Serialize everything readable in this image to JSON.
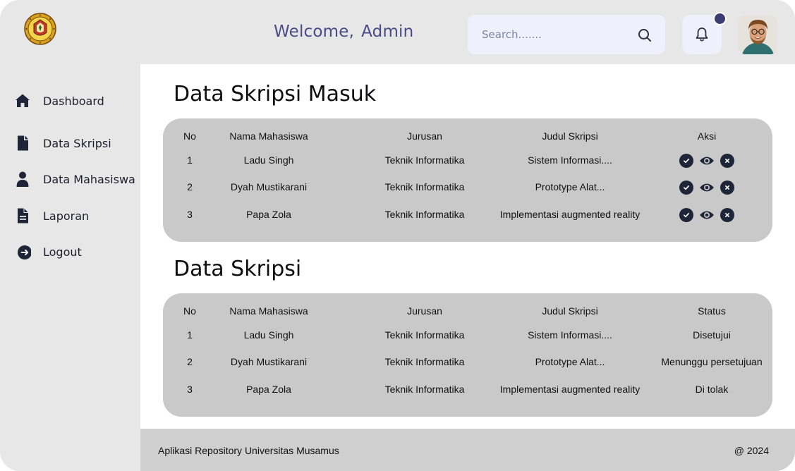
{
  "header": {
    "welcome_text": "Welcome,",
    "user_name": "Admin",
    "search_placeholder": "Search......."
  },
  "sidebar": {
    "items": [
      {
        "label": "Dashboard",
        "icon": "home-icon"
      },
      {
        "label": "Data Skripsi",
        "icon": "file-icon"
      },
      {
        "label": "Data Mahasiswa",
        "icon": "user-icon"
      },
      {
        "label": "Laporan",
        "icon": "document-icon"
      },
      {
        "label": "Logout",
        "icon": "logout-icon"
      }
    ]
  },
  "incoming": {
    "title": "Data Skripsi Masuk",
    "headers": [
      "No",
      "Nama Mahasiswa",
      "Jurusan",
      "Judul Skripsi",
      "Aksi"
    ],
    "rows": [
      {
        "no": "1",
        "name": "Ladu Singh",
        "major": "Teknik Informatika",
        "title": "Sistem Informasi...."
      },
      {
        "no": "2",
        "name": "Dyah Mustikarani",
        "major": "Teknik Informatika",
        "title": "Prototype Alat..."
      },
      {
        "no": "3",
        "name": "Papa Zola",
        "major": "Teknik Informatika",
        "title": "Implementasi augmented reality"
      }
    ]
  },
  "data": {
    "title": "Data Skripsi",
    "headers": [
      "No",
      "Nama Mahasiswa",
      "Jurusan",
      "Judul Skripsi",
      "Status"
    ],
    "rows": [
      {
        "no": "1",
        "name": "Ladu Singh",
        "major": "Teknik Informatika",
        "title": "Sistem Informasi....",
        "status": "Disetujui"
      },
      {
        "no": "2",
        "name": "Dyah Mustikarani",
        "major": "Teknik Informatika",
        "title": "Prototype Alat...",
        "status": "Menunggu persetujuan"
      },
      {
        "no": "3",
        "name": "Papa Zola",
        "major": "Teknik Informatika",
        "title": "Implementasi augmented reality",
        "status": "Di tolak"
      }
    ]
  },
  "footer": {
    "app_name": "Aplikasi Repository Universitas Musamus",
    "year": "@ 2024"
  },
  "colors": {
    "accent": "#4a4a87",
    "notification_dot": "#3c3c72",
    "action_button": "#1f2538",
    "card_bg": "#c9c9c9",
    "sidebar_bg": "#e7e7e7"
  }
}
